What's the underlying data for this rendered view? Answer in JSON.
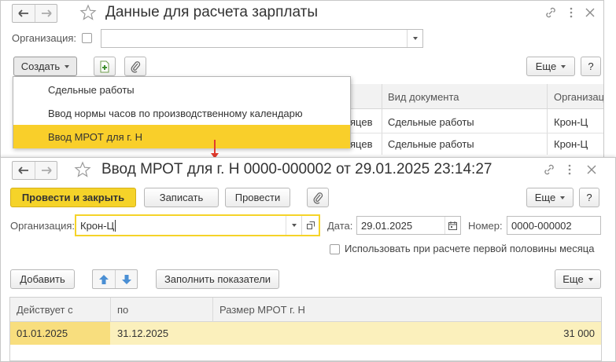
{
  "window1": {
    "title": "Данные для расчета зарплаты",
    "org_label": "Организация:",
    "org_value": "",
    "create_label": "Создать",
    "more_label": "Еще",
    "help_label": "?",
    "columns": [
      "Вид документа",
      "Организац"
    ],
    "rows": [
      {
        "partial": "яцев",
        "doc_type": "Сдельные работы",
        "org": "Крон-Ц"
      },
      {
        "partial": "яцев",
        "doc_type": "Сдельные работы",
        "org": "Крон-Ц"
      }
    ],
    "menu": [
      {
        "label": "Сдельные работы",
        "selected": false
      },
      {
        "label": "Ввод нормы часов по производственному календарю",
        "selected": false
      },
      {
        "label": "Ввод МРОТ для г. Н",
        "selected": true
      }
    ]
  },
  "window2": {
    "title": "Ввод МРОТ для г. Н 0000-000002 от 29.01.2025 23:14:27",
    "post_close_label": "Провести и закрыть",
    "save_label": "Записать",
    "post_label": "Провести",
    "more_label": "Еще",
    "help_label": "?",
    "org_label": "Организация:",
    "org_value": "Крон-Ц",
    "date_label": "Дата:",
    "date_value": "29.01.2025",
    "number_label": "Номер:",
    "number_value": "0000-000002",
    "half_month_label": "Использовать при расчете первой половины месяца",
    "add_label": "Добавить",
    "fill_label": "Заполнить показатели",
    "table_more_label": "Еще",
    "columns": [
      "Действует с",
      "по",
      "Размер МРОТ г. Н"
    ],
    "rows": [
      {
        "from": "01.01.2025",
        "to": "31.12.2025",
        "amount": "31 000"
      }
    ]
  },
  "colors": {
    "accent": "#f5d329",
    "selected_row": "#fbeeb0",
    "arrow": "#e03b2e"
  }
}
